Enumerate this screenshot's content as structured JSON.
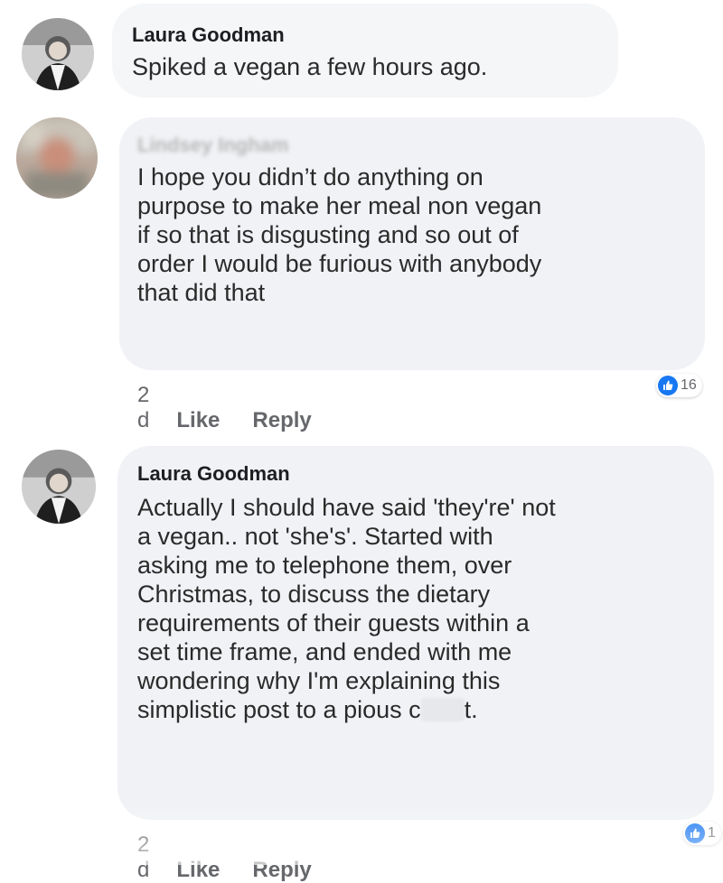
{
  "comments": [
    {
      "author": "Laura Goodman",
      "text": "Spiked a vegan a few hours ago.",
      "avatar_icon": "profile-photo"
    },
    {
      "author": "Lindsey Ingham",
      "text": "I hope you didn’t do anything on\npurpose to make her meal non vegan\nif so that is disgusting and so out of\norder I would be furious with anybody\nthat did that",
      "time": "2 d",
      "like_label": "Like",
      "reply_label": "Reply",
      "reaction_count": "16",
      "avatar_icon": "blurred-profile-photo"
    },
    {
      "author": "Laura Goodman",
      "text_before_redaction": "Actually I should have said 'they're' not\na vegan.. not 'she's'. Started with\nasking me to telephone them, over\nChristmas, to discuss the dietary\nrequirements of their guests within a\nset time frame, and ended with me\nwondering why I'm explaining this\nsimplistic post to a pious c",
      "text_after_redaction": "t.",
      "time": "2 d",
      "like_label": "Like",
      "reply_label": "Reply",
      "reaction_count": "1",
      "avatar_icon": "profile-photo"
    }
  ],
  "colors": {
    "bubble": "#f0f2f5",
    "like_blue": "#1877f2",
    "meta_gray": "#65676b"
  }
}
